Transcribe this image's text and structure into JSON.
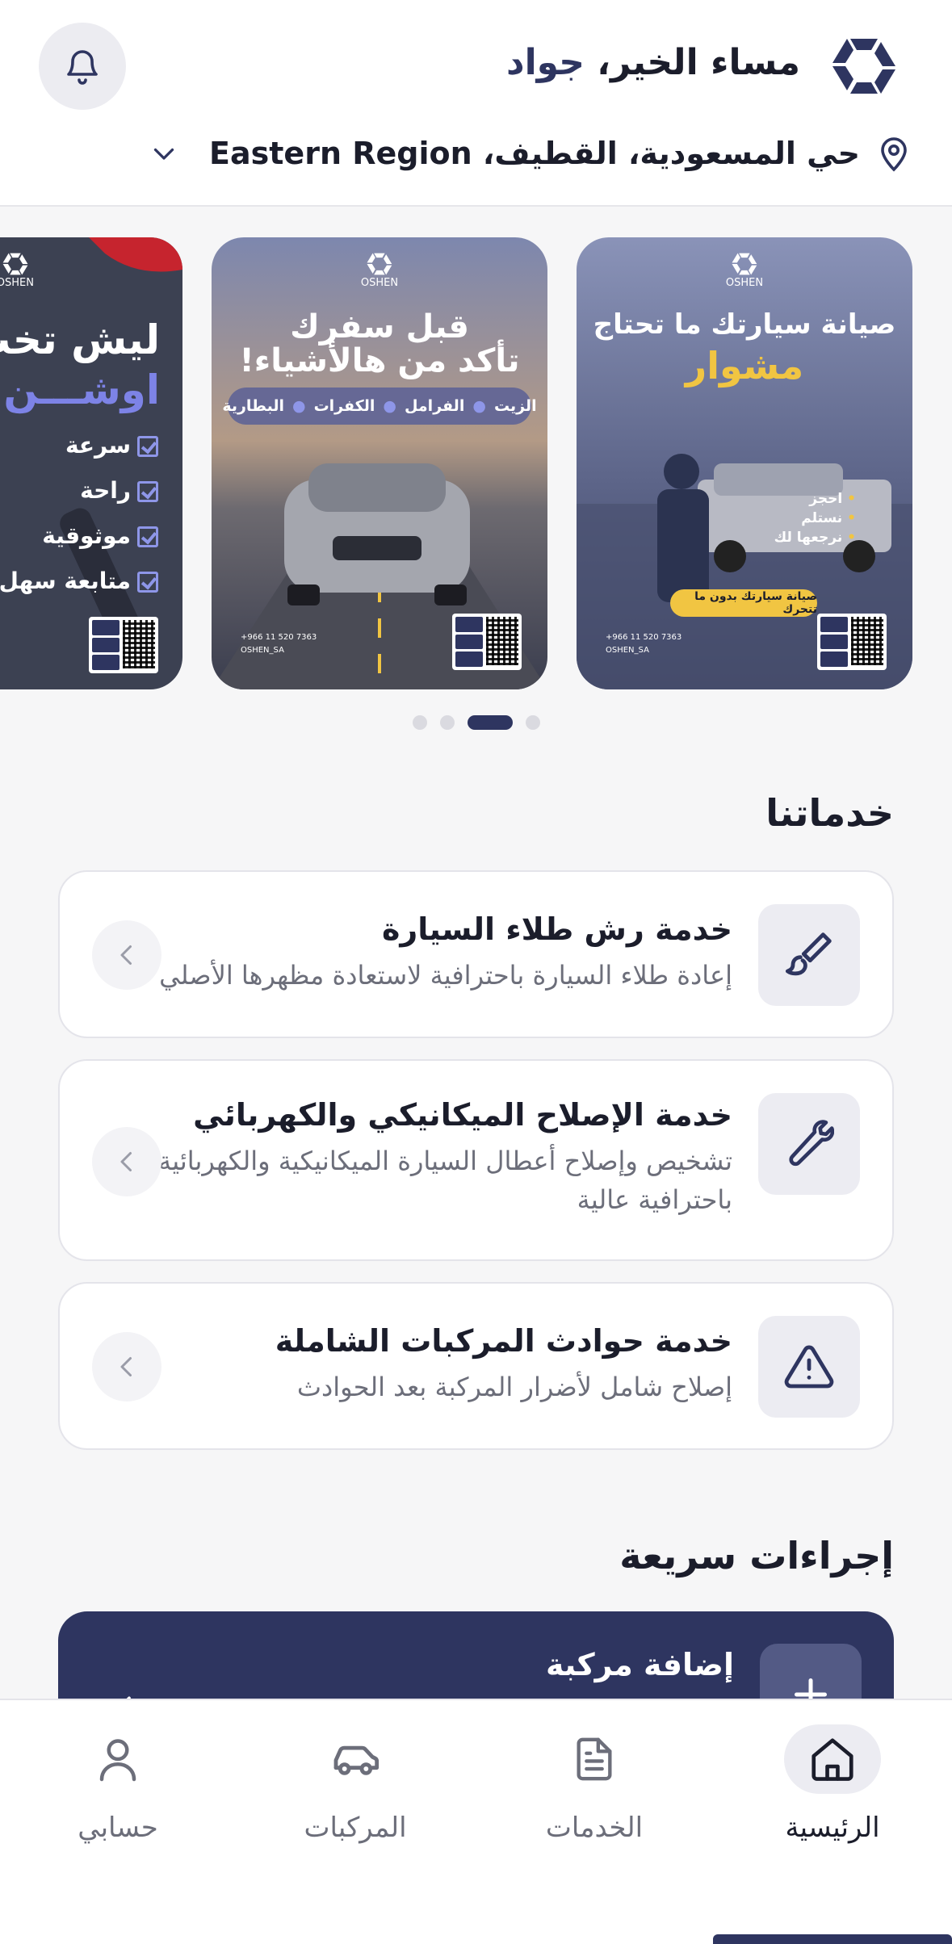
{
  "header": {
    "greeting_prefix": "مساء الخير، ",
    "user_name": "جواد",
    "location": "حي المسعودية، القطيف، Eastern Region",
    "icons": {
      "notifications": "bell-icon",
      "location": "map-pin-icon",
      "dropdown": "chevron-down-icon",
      "logo": "oshen-logo"
    }
  },
  "carousel": {
    "active_index": 2,
    "dots_count": 4,
    "banners": [
      {
        "brand": "OSHEN",
        "title": "صيانة سيارتك ما تحتاج",
        "highlight": "مشوار",
        "steps": [
          "احجز",
          "نستلم",
          "نرجعها لك"
        ],
        "cta": "صيانة سيارتك بدون ما تتحرك",
        "phone": "+966 11 520 7363",
        "handle": "OSHEN_SA"
      },
      {
        "brand": "OSHEN",
        "title": "قبل سفرك",
        "highlight": "تأكد من هالأشياء!",
        "pill_items": [
          "الزيت",
          "الفرامل",
          "الكفرات",
          "البطارية"
        ],
        "phone": "+966 11 520 7363",
        "handle": "OSHEN_SA"
      },
      {
        "brand": "OSHEN",
        "title": "ليش تخت",
        "highlight": "اوشـــن",
        "checks": [
          "سرعة",
          "راحة",
          "موثوقية",
          "متابعة سهل"
        ]
      }
    ]
  },
  "services": {
    "title": "خدماتنا",
    "items": [
      {
        "title": "خدمة رش طلاء السيارة",
        "description": "إعادة طلاء السيارة باحترافية لاستعادة مظهرها الأصلي",
        "icon": "paint-brush-icon"
      },
      {
        "title": "خدمة الإصلاح الميكانيكي والكهربائي",
        "description": "تشخيص وإصلاح أعطال السيارة الميكانيكية والكهربائية باحترافية عالية",
        "icon": "wrench-icon"
      },
      {
        "title": "خدمة حوادث المركبات الشاملة",
        "description": "إصلاح شامل لأضرار المركبة بعد الحوادث",
        "icon": "warning-triangle-icon"
      }
    ]
  },
  "quick_actions": {
    "title": "إجراءات سريعة",
    "items": [
      {
        "title": "إضافة مركبة",
        "icon": "plus-icon"
      }
    ]
  },
  "bottom_nav": {
    "items": [
      {
        "label": "الرئيسية",
        "icon": "home-icon",
        "active": true
      },
      {
        "label": "الخدمات",
        "icon": "document-icon",
        "active": false
      },
      {
        "label": "المركبات",
        "icon": "car-icon",
        "active": false
      },
      {
        "label": "حسابي",
        "icon": "user-icon",
        "active": false
      }
    ]
  },
  "colors": {
    "primary": "#2e3560",
    "accent": "#f1c542",
    "background": "#f6f6f7",
    "card": "#ffffff",
    "muted_text": "#6c6e7a"
  }
}
